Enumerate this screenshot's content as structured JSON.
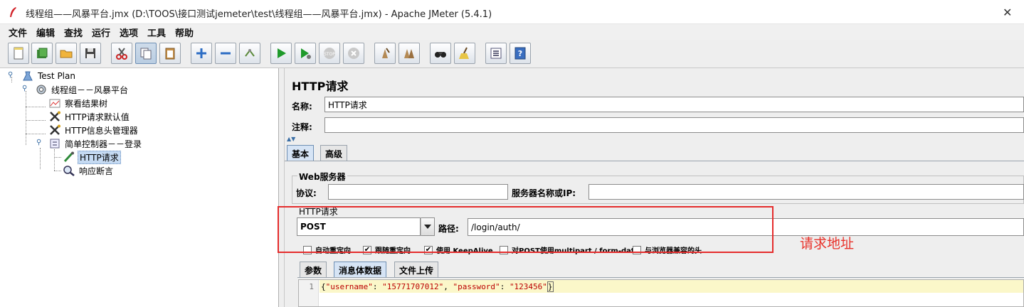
{
  "window": {
    "title": "线程组——风暴平台.jmx (D:\\TOOS\\接口测试jemeter\\test\\线程组——风暴平台.jmx) - Apache JMeter (5.4.1)",
    "close_glyph": "✕"
  },
  "menu": [
    "文件",
    "编辑",
    "查找",
    "运行",
    "选项",
    "工具",
    "帮助"
  ],
  "toolbar": {
    "buttons": [
      "new-icon",
      "templates-icon",
      "open-icon",
      "save-icon",
      "cut-icon",
      "copy-icon",
      "paste-icon",
      "expand-icon",
      "collapse-icon",
      "toggle-icon",
      "start-icon",
      "start-no-pauses-icon",
      "stop-icon",
      "shutdown-icon",
      "clear-icon",
      "clear-all-icon",
      "search-icon",
      "reset-search-icon",
      "function-helper-icon",
      "help-icon"
    ]
  },
  "tree": {
    "nodes": [
      {
        "label": "Test Plan",
        "icon": "test-plan-icon"
      },
      {
        "label": "线程组－－风暴平台",
        "icon": "thread-group-icon"
      },
      {
        "label": "察看结果树",
        "icon": "results-tree-icon"
      },
      {
        "label": "HTTP请求默认值",
        "icon": "config-tools-icon"
      },
      {
        "label": "HTTP信息头管理器",
        "icon": "config-tools-icon"
      },
      {
        "label": "简单控制器－－登录",
        "icon": "controller-icon"
      },
      {
        "label": "HTTP请求",
        "icon": "sampler-pen-icon"
      },
      {
        "label": "响应断言",
        "icon": "assertion-magnifier-icon"
      }
    ]
  },
  "editor": {
    "title": "HTTP请求",
    "name_label": "名称:",
    "name_value": "HTTP请求",
    "comment_label": "注释:",
    "comment_value": "",
    "tabs": [
      "基本",
      "高级"
    ],
    "web_server": {
      "group_title": "Web服务器",
      "protocol_label": "协议:",
      "protocol_value": "",
      "server_label": "服务器名称或IP:",
      "server_value": ""
    },
    "http_request": {
      "group_title": "HTTP请求",
      "method": "POST",
      "path_label": "路径:",
      "path_value": "/login/auth/"
    },
    "checkboxes": [
      {
        "label": "自动重定向",
        "checked": false
      },
      {
        "label": "跟随重定向",
        "checked": true
      },
      {
        "label": "使用 KeepAlive",
        "checked": true
      },
      {
        "label": "对POST使用multipart / form-data",
        "checked": false
      },
      {
        "label": "与浏览器兼容的头",
        "checked": false
      }
    ],
    "check_glyph": "✔",
    "body_tabs": [
      "参数",
      "消息体数据",
      "文件上传"
    ],
    "body": {
      "line_number": "1",
      "json": {
        "open": "{",
        "k1": "\"username\"",
        "sep1": ": ",
        "v1": "\"15771707012\"",
        "comma": ", ",
        "k2": "\"password\"",
        "sep2": ": ",
        "v2": "\"123456\"",
        "close": "}"
      }
    }
  },
  "annotation": {
    "text": "请求地址",
    "color": "#e8322a"
  },
  "colors": {
    "selection": "#c5daf2",
    "highlight_border": "#e52c2c",
    "code_line_bg": "#fbf7c9"
  }
}
